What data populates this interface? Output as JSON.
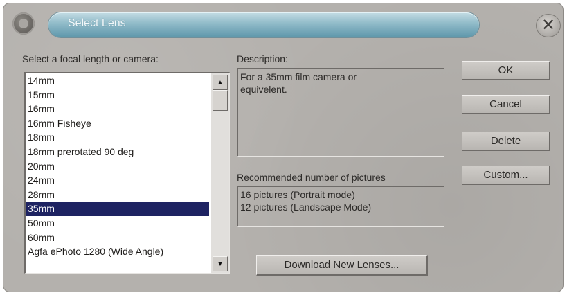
{
  "window": {
    "title": "Select Lens",
    "close_glyph": "✕"
  },
  "lens_list": {
    "label": "Select a focal length or camera:",
    "items": [
      "14mm",
      "15mm",
      "16mm",
      "16mm Fisheye",
      "18mm",
      "18mm prerotated 90 deg",
      "20mm",
      "24mm",
      "28mm",
      "35mm",
      "50mm",
      "60mm",
      "Agfa ePhoto 1280 (Wide Angle)"
    ],
    "selected": "35mm",
    "scroll_up": "▲",
    "scroll_down": "▼"
  },
  "description": {
    "label": "Description:",
    "text": "For a 35mm film camera or equivelent."
  },
  "recommended": {
    "label": "Recommended number of pictures",
    "lines": [
      "16 pictures (Portrait mode)",
      "12 pictures (Landscape Mode)"
    ]
  },
  "buttons": {
    "ok": "OK",
    "cancel": "Cancel",
    "delete": "Delete",
    "custom": "Custom...",
    "download": "Download New Lenses..."
  },
  "colors": {
    "selection": "#1e2362",
    "title_bar": "#8fbac8",
    "dialog_bg": "#b4b1ad"
  }
}
